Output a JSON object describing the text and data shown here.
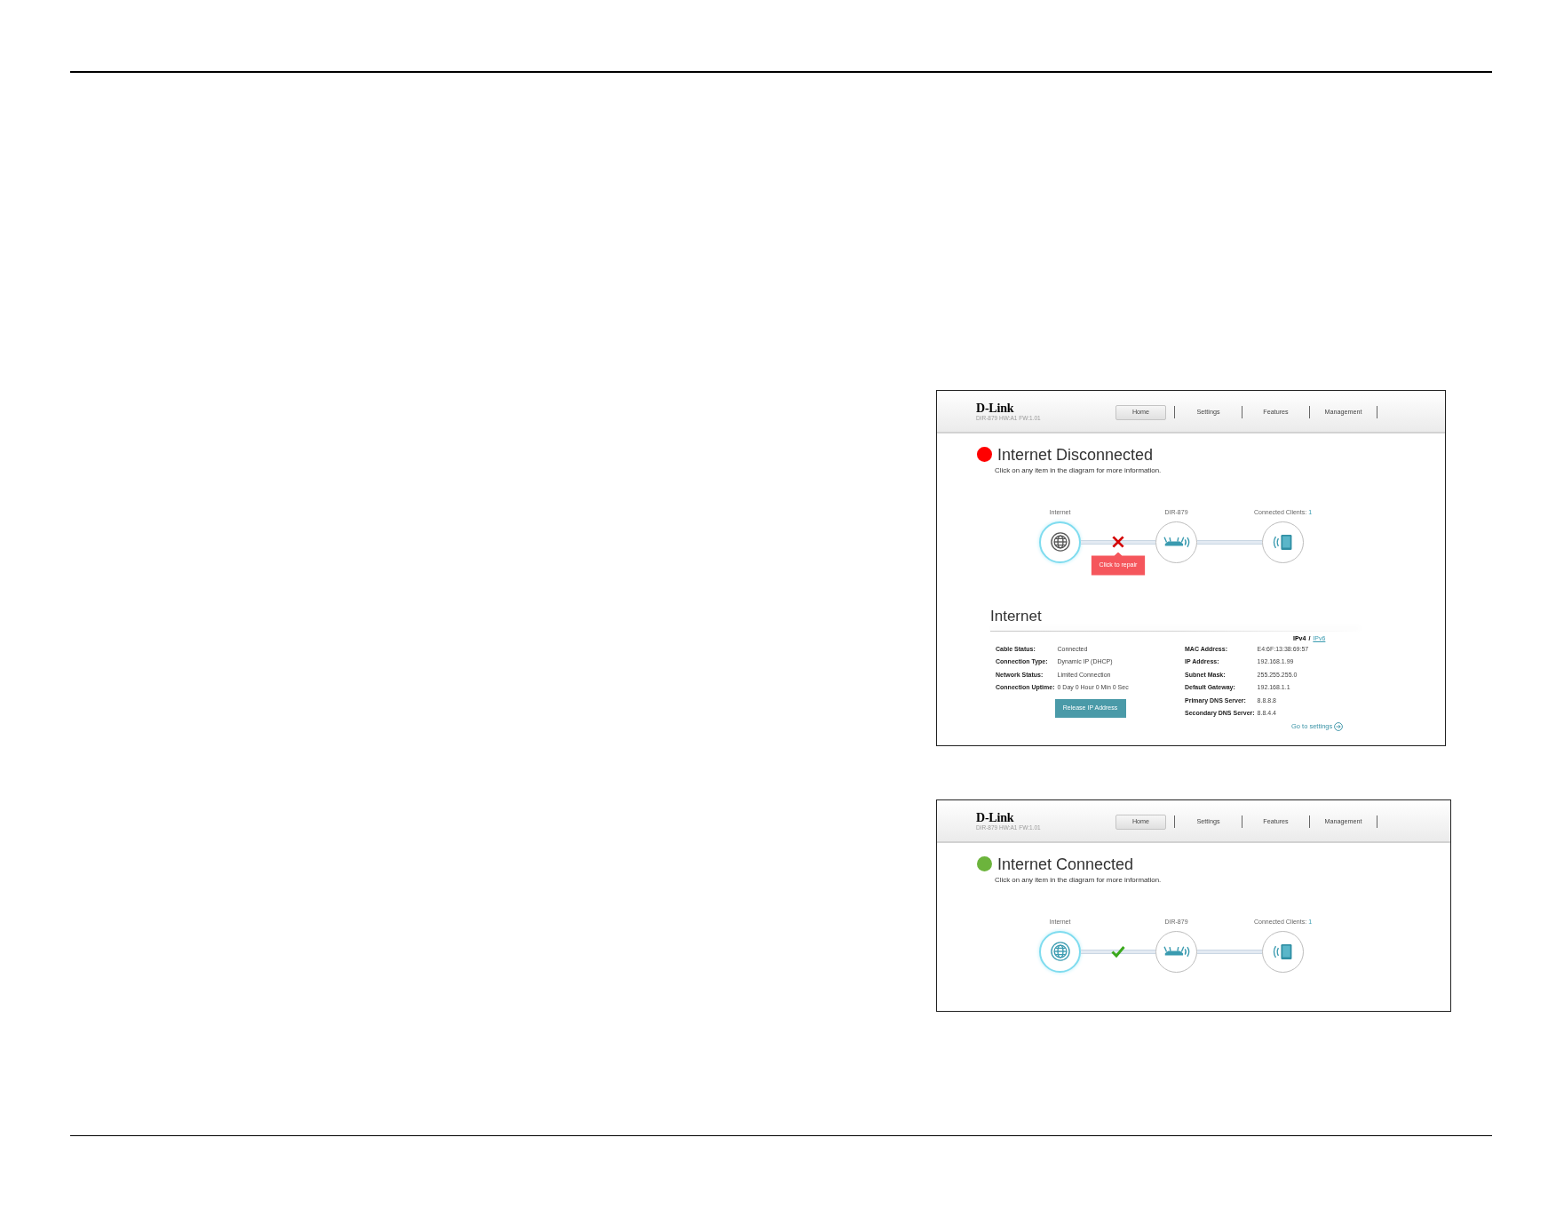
{
  "screenshots": [
    {
      "connected": false,
      "header": {
        "logo": "D-Link",
        "model_info": "DIR-879 HW:A1 FW:1.01",
        "nav": [
          {
            "label": "Home",
            "selected": true
          },
          {
            "label": "Settings",
            "selected": false
          },
          {
            "label": "Features",
            "selected": false
          },
          {
            "label": "Management",
            "selected": false
          }
        ]
      },
      "status": {
        "title": "Internet Disconnected",
        "description": "Click on any item in the diagram for more information."
      },
      "diagram": {
        "nodes": [
          {
            "kind": "internet",
            "label": "Internet",
            "selected": true
          },
          {
            "kind": "router",
            "label": "DIR-879",
            "selected": false
          },
          {
            "kind": "clients",
            "label": "Connected Clients:",
            "count": "1",
            "selected": false
          }
        ],
        "repair_tooltip": "Click to repair"
      },
      "internet_panel": {
        "title": "Internet",
        "ip_versions": [
          {
            "label": "IPv4",
            "selected": true
          },
          {
            "label": "IPv6",
            "selected": false
          }
        ],
        "ip_separator": "/",
        "left_fields": [
          {
            "label": "Cable Status:",
            "value": "Connected"
          },
          {
            "label": "Connection Type:",
            "value": "Dynamic IP (DHCP)"
          },
          {
            "label": "Network Status:",
            "value": "Limited Connection"
          },
          {
            "label": "Connection Uptime:",
            "value": "0 Day 0 Hour 0 Min 0 Sec"
          }
        ],
        "right_fields": [
          {
            "label": "MAC Address:",
            "value": "E4:6F:13:38:69:57"
          },
          {
            "label": "IP Address:",
            "value": "192.168.1.99"
          },
          {
            "label": "Subnet Mask:",
            "value": "255.255.255.0"
          },
          {
            "label": "Default Gateway:",
            "value": "192.168.1.1"
          },
          {
            "label": "Primary DNS Server:",
            "value": "8.8.8.8"
          },
          {
            "label": "Secondary DNS Server:",
            "value": "8.8.4.4"
          }
        ],
        "release_button": "Release IP Address",
        "settings_link": "Go to settings"
      }
    },
    {
      "connected": true,
      "header": {
        "logo": "D-Link",
        "model_info": "DIR-879 HW:A1 FW:1.01",
        "nav": [
          {
            "label": "Home",
            "selected": true
          },
          {
            "label": "Settings",
            "selected": false
          },
          {
            "label": "Features",
            "selected": false
          },
          {
            "label": "Management",
            "selected": false
          }
        ]
      },
      "status": {
        "title": "Internet Connected",
        "description": "Click on any item in the diagram for more information."
      },
      "diagram": {
        "nodes": [
          {
            "kind": "internet",
            "label": "Internet",
            "selected": true
          },
          {
            "kind": "router",
            "label": "DIR-879",
            "selected": false
          },
          {
            "kind": "clients",
            "label": "Connected Clients:",
            "count": "1",
            "selected": false
          }
        ]
      }
    }
  ]
}
